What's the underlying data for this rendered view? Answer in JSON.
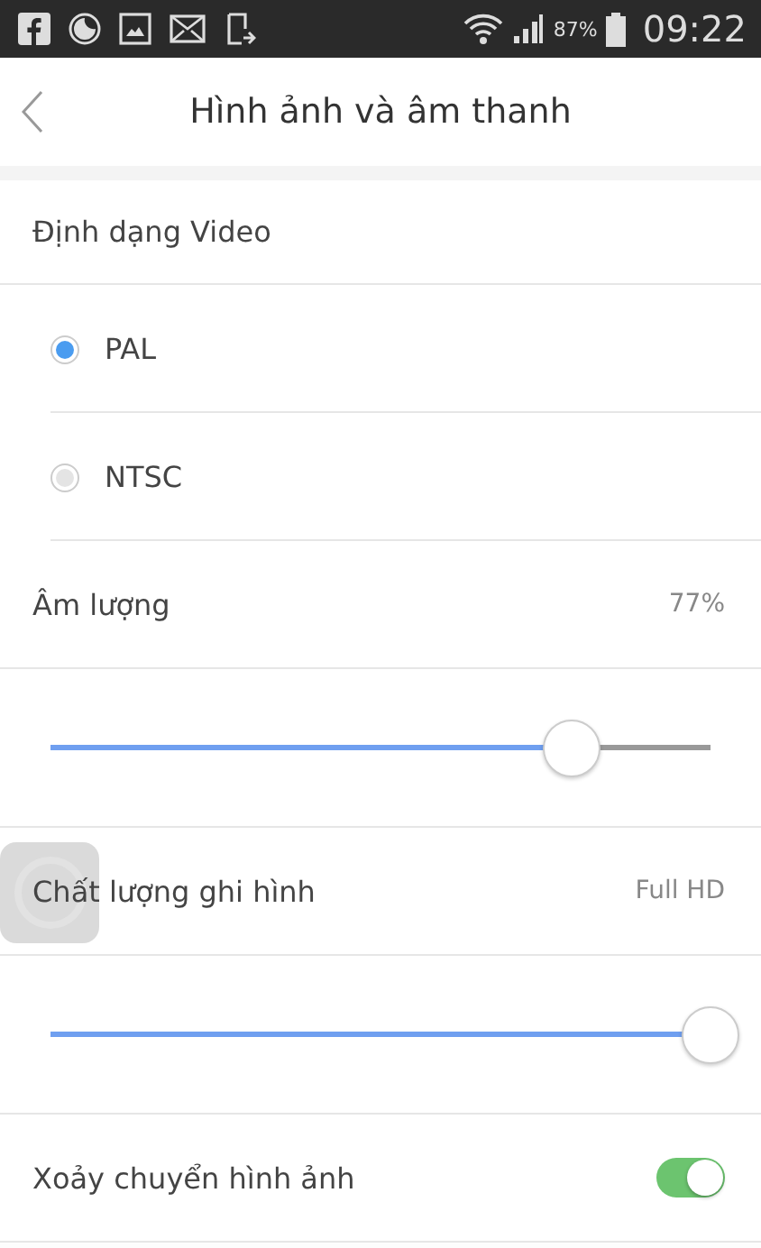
{
  "status_bar": {
    "battery_text": "87%",
    "time": "09:22"
  },
  "header": {
    "title": "Hình ảnh và âm thanh"
  },
  "rows": [
    {
      "kind": "section",
      "label": "Định dạng Video"
    },
    {
      "kind": "radio",
      "label": "PAL",
      "selected": true
    },
    {
      "kind": "radio",
      "label": "NTSC",
      "selected": false
    },
    {
      "kind": "value",
      "label": "Âm lượng",
      "value": "77%"
    },
    {
      "kind": "slider",
      "level": 0.78
    },
    {
      "kind": "value",
      "label": "Chất lượng ghi hình",
      "value": "Full HD"
    },
    {
      "kind": "slider",
      "level": 1
    },
    {
      "kind": "toggle",
      "label": "Xoảy chuyển hình ảnh",
      "on": true
    }
  ]
}
